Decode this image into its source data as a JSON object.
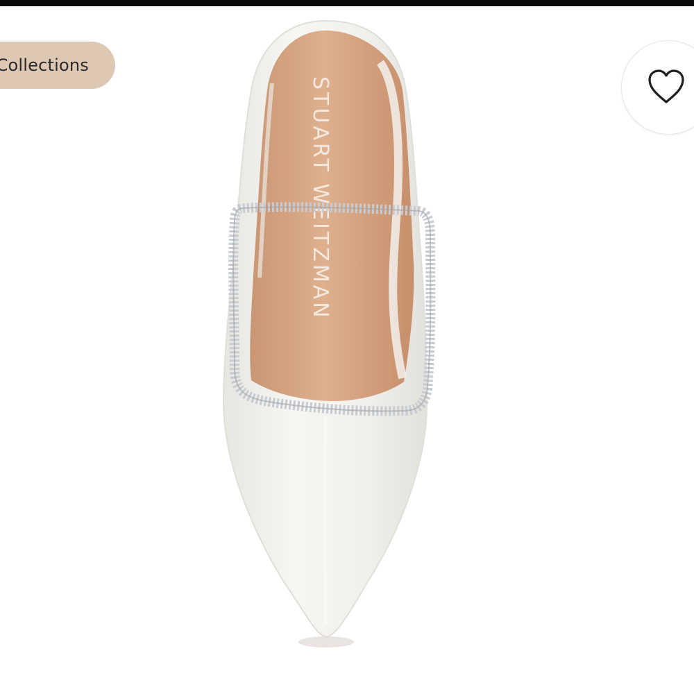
{
  "collections_button": {
    "label": "Collections"
  },
  "favorite_button": {
    "icon": "heart-outline-icon"
  },
  "product": {
    "image": "white-pointed-mule-with-crystal-strap",
    "insole_brand": "STUART WEITZMAN"
  },
  "colors": {
    "pill": "#dcc8b3",
    "shoe": "#f4f3ef",
    "insole": "#d6a784",
    "crystal": "#c8ccd2"
  }
}
